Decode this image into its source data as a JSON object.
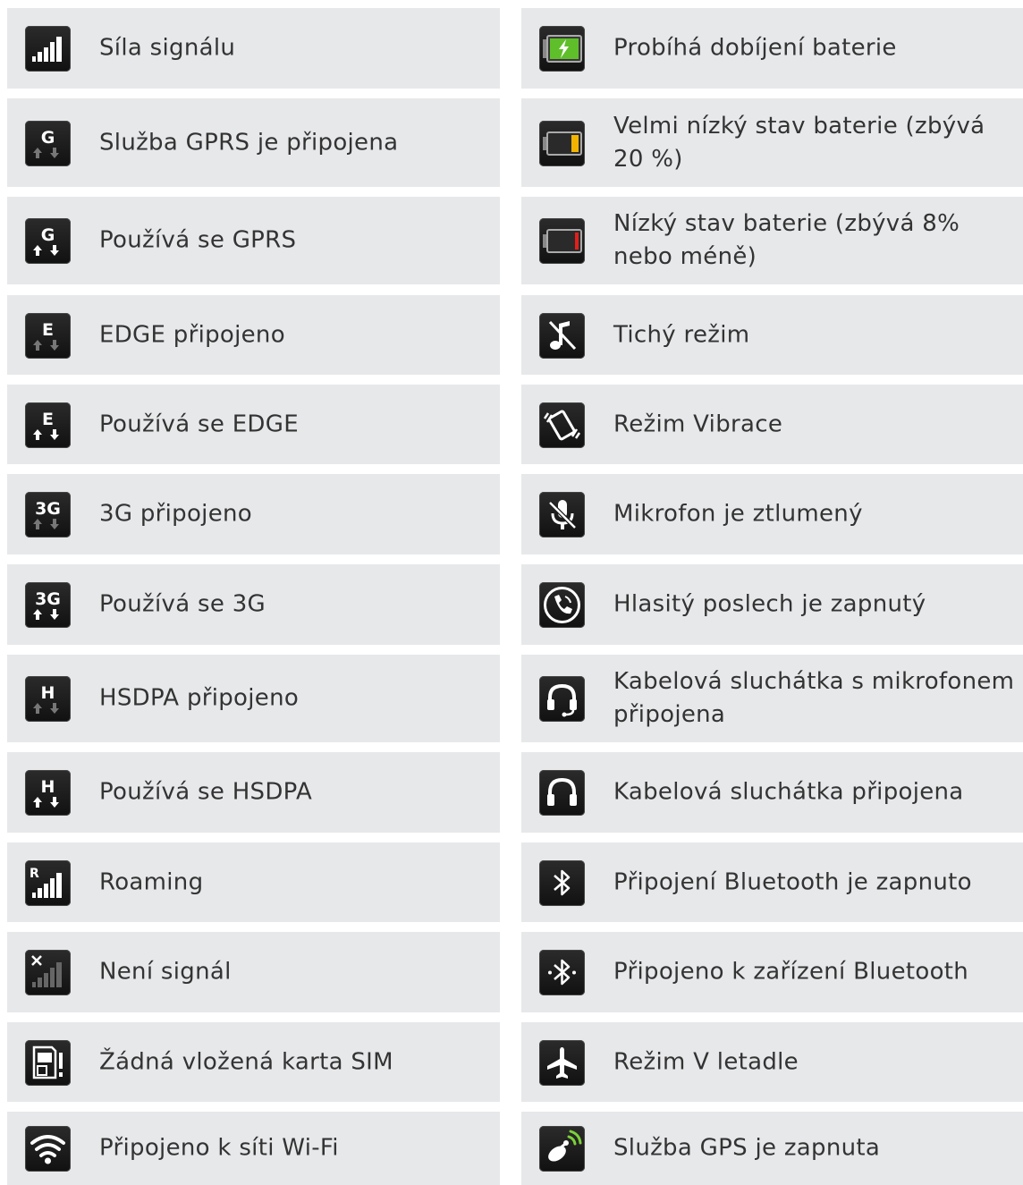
{
  "left_items": [
    {
      "icon": "signal-strength-icon",
      "label": "Síla signálu"
    },
    {
      "icon": "gprs-connected-icon",
      "label": "Služba GPRS je připojena"
    },
    {
      "icon": "gprs-in-use-icon",
      "label": "Používá se GPRS"
    },
    {
      "icon": "edge-connected-icon",
      "label": "EDGE připojeno"
    },
    {
      "icon": "edge-in-use-icon",
      "label": "Používá se EDGE"
    },
    {
      "icon": "3g-connected-icon",
      "label": "3G připojeno"
    },
    {
      "icon": "3g-in-use-icon",
      "label": "Používá se 3G"
    },
    {
      "icon": "hsdpa-connected-icon",
      "label": "HSDPA připojeno"
    },
    {
      "icon": "hsdpa-in-use-icon",
      "label": "Používá se HSDPA"
    },
    {
      "icon": "roaming-icon",
      "label": "Roaming"
    },
    {
      "icon": "no-signal-icon",
      "label": "Není signál"
    },
    {
      "icon": "no-sim-icon",
      "label": "Žádná vložená karta SIM"
    },
    {
      "icon": "wifi-icon",
      "label": "Připojeno k síti Wi-Fi"
    }
  ],
  "right_items": [
    {
      "icon": "battery-charging-icon",
      "label": "Probíhá dobíjení baterie"
    },
    {
      "icon": "battery-very-low-icon",
      "label": "Velmi nízký stav baterie (zbývá 20 %)"
    },
    {
      "icon": "battery-low-icon",
      "label": "Nízký stav baterie (zbývá 8% nebo méně)"
    },
    {
      "icon": "silent-mode-icon",
      "label": "Tichý režim"
    },
    {
      "icon": "vibrate-mode-icon",
      "label": "Režim Vibrace"
    },
    {
      "icon": "mic-muted-icon",
      "label": "Mikrofon je ztlumený"
    },
    {
      "icon": "speakerphone-icon",
      "label": "Hlasitý poslech je zapnutý"
    },
    {
      "icon": "wired-headset-mic-icon",
      "label": "Kabelová sluchátka s mikrofonem připojena"
    },
    {
      "icon": "wired-headphones-icon",
      "label": "Kabelová sluchátka připojena"
    },
    {
      "icon": "bluetooth-on-icon",
      "label": "Připojení Bluetooth je zapnuto"
    },
    {
      "icon": "bluetooth-connected-icon",
      "label": "Připojeno k zařízení Bluetooth"
    },
    {
      "icon": "airplane-mode-icon",
      "label": "Režim V letadle"
    },
    {
      "icon": "gps-on-icon",
      "label": "Služba GPS je zapnuta"
    }
  ],
  "colors": {
    "row_bg": "#e7e8ea",
    "text": "#333333",
    "icon_bg": "#1a1a1a",
    "battery_green": "#5fbf2a",
    "battery_yellow": "#f2b400",
    "battery_red": "#e0201b",
    "gps_green": "#7ccf3a"
  }
}
